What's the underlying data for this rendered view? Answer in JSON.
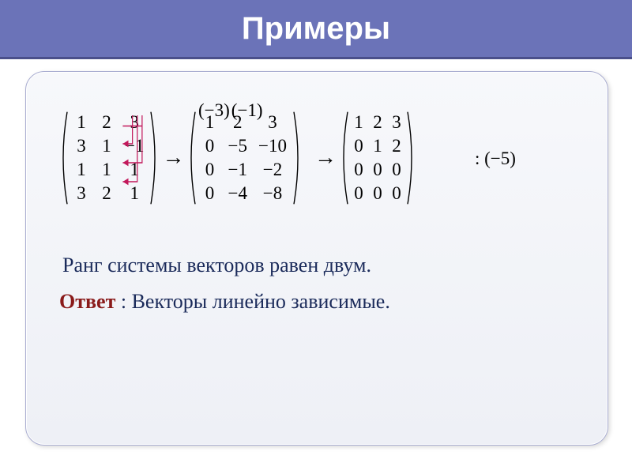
{
  "title": "Примеры",
  "ops1_a": "(−3)",
  "ops1_b": "(−1)",
  "ops2": ": (−5)",
  "arrow": "→",
  "matrixA": [
    [
      "1",
      "2",
      "3"
    ],
    [
      "3",
      "1",
      "−1"
    ],
    [
      "1",
      "1",
      "1"
    ],
    [
      "3",
      "2",
      "1"
    ]
  ],
  "matrixB": [
    [
      "1",
      "2",
      "3"
    ],
    [
      "0",
      "−5",
      "−10"
    ],
    [
      "0",
      "−1",
      "−2"
    ],
    [
      "0",
      "−4",
      "−8"
    ]
  ],
  "matrixC": [
    [
      "1",
      "2",
      "3"
    ],
    [
      "0",
      "1",
      "2"
    ],
    [
      "0",
      "0",
      "0"
    ],
    [
      "0",
      "0",
      "0"
    ]
  ],
  "line_rank": "Ранг системы векторов   равен двум.",
  "answer_label": "Ответ",
  "answer_rest": " : Векторы линейно зависимые."
}
